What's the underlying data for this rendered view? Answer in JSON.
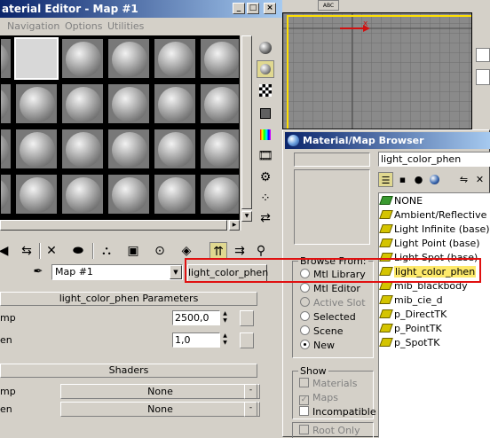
{
  "material_editor": {
    "title": "aterial Editor - Map #1",
    "menus": [
      "Navigation",
      "Options",
      "Utilities"
    ],
    "map_name": "Map #1",
    "map_type_button": "light_color_phen",
    "params_rollout": "light_color_phen Parameters",
    "params": [
      {
        "label": "mp",
        "value": "2500,0"
      },
      {
        "label": "en",
        "value": "1,0"
      }
    ],
    "shaders_rollout": "Shaders",
    "shaders": [
      {
        "label": "mp",
        "value": "None"
      },
      {
        "label": "en",
        "value": "None"
      }
    ]
  },
  "viewport": {
    "axis_label": "x",
    "toolbar_badge": "ABC"
  },
  "browser": {
    "title": "Material/Map Browser",
    "search_value": "light_color_phen",
    "list": [
      "NONE",
      "Ambient/Reflective O",
      "Light Infinite (base)",
      "Light Point (base)",
      "Light Spot (base)",
      "light_color_phen",
      "mib_blackbody",
      "mib_cie_d",
      "p_DirectTK",
      "p_PointTK",
      "p_SpotTK"
    ],
    "selected_index": 5,
    "browse_from": {
      "label": "Browse From:",
      "options": [
        "Mtl Library",
        "Mtl Editor",
        "Active Slot",
        "Selected",
        "Scene",
        "New"
      ],
      "selected": "New",
      "disabled": [
        "Active Slot"
      ]
    },
    "show": {
      "label": "Show",
      "options": [
        {
          "label": "Materials",
          "checked": false,
          "disabled": true
        },
        {
          "label": "Maps",
          "checked": true,
          "disabled": true
        },
        {
          "label": "Incompatible",
          "checked": false,
          "disabled": false
        }
      ]
    },
    "root_only": {
      "label": "Root Only",
      "checked": false,
      "disabled": true
    }
  },
  "colors": {
    "annotation": "#e01010",
    "selection_highlight": "#fde96a",
    "title_gradient_start": "#0a246a",
    "viewport_frame": "#ffe000"
  }
}
